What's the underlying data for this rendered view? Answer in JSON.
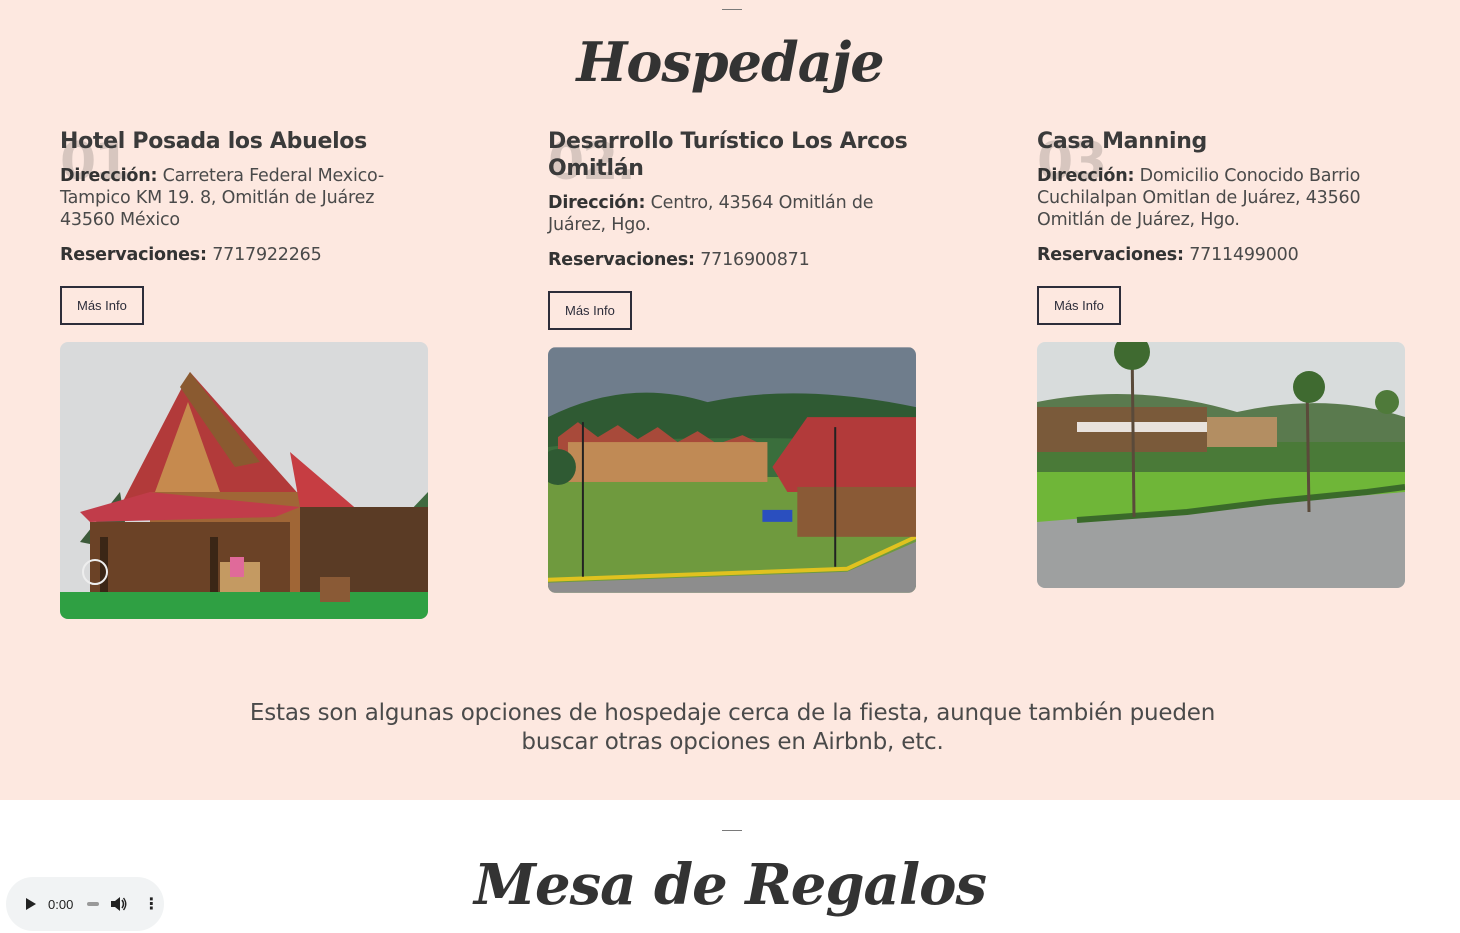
{
  "hospedaje": {
    "title": "Hospedaje",
    "cards": [
      {
        "number": "01",
        "name": "Hotel Posada los Abuelos",
        "address_label": "Dirección:",
        "address": "Carretera Federal Mexico-Tampico KM 19. 8, Omitlán de Juárez 43560 México",
        "res_label": "Reservaciones:",
        "phone": "7717922265",
        "button": "Más Info"
      },
      {
        "number": "02.",
        "name": "Desarrollo Turístico Los Arcos Omitlán",
        "address_label": "Dirección:",
        "address": "Centro, 43564 Omitlán de Juárez, Hgo.",
        "res_label": "Reservaciones:",
        "phone": "7716900871",
        "button": "Más Info"
      },
      {
        "number": "03",
        "name": "Casa Manning",
        "address_label": "Dirección:",
        "address": "Domicilio Conocido Barrio Cuchilalpan Omitlan de Juárez, 43560 Omitlán de Juárez, Hgo.",
        "res_label": "Reservaciones:",
        "phone": "7711499000",
        "button": "Más Info"
      }
    ],
    "note": "Estas son algunas opciones de hospedaje cerca de la fiesta, aunque también pueden buscar otras opciones en Airbnb, etc."
  },
  "regalos": {
    "title": "Mesa de Regalos"
  },
  "audio_player": {
    "time": "0:00",
    "play_icon": "play-icon",
    "volume_icon": "volume-icon",
    "menu_icon": "more-options-icon"
  }
}
